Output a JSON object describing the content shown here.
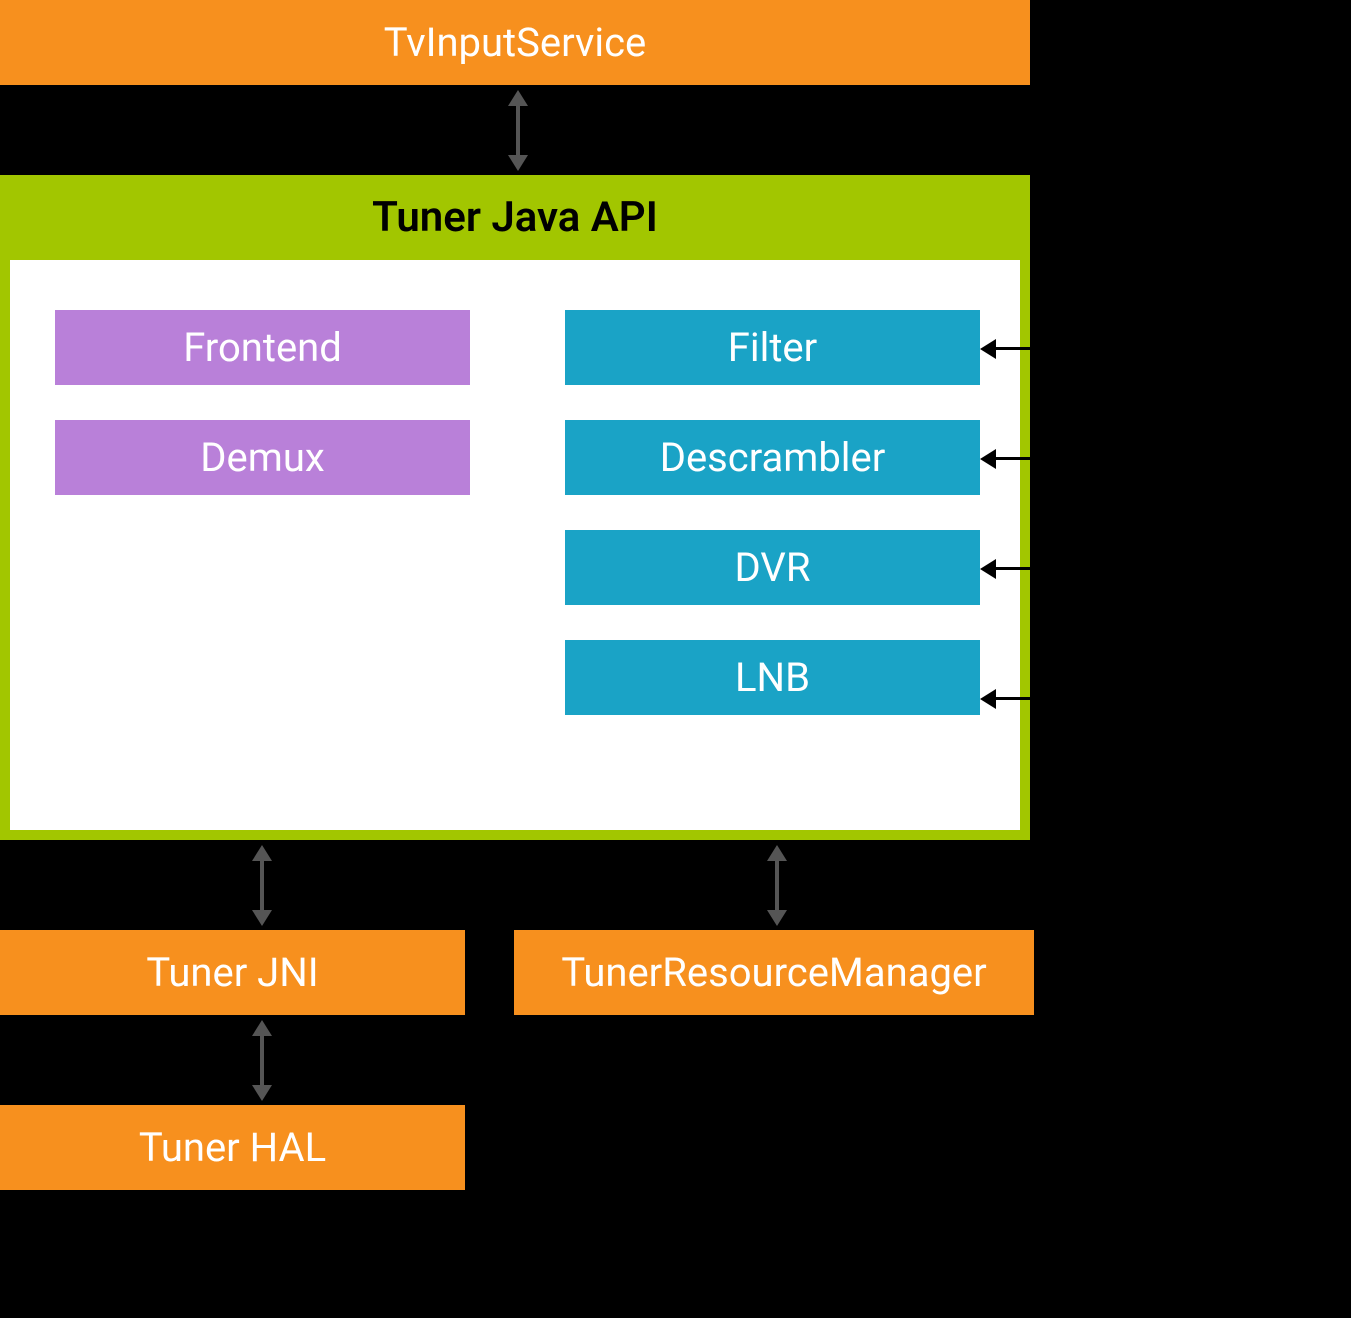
{
  "top": {
    "tv_input_service": "TvInputService"
  },
  "tuner_api": {
    "header": "Tuner Java API",
    "left": {
      "frontend": "Frontend",
      "demux": "Demux"
    },
    "right": {
      "filter": "Filter",
      "descrambler": "Descrambler",
      "dvr": "DVR",
      "lnb": "LNB"
    }
  },
  "bottom": {
    "tuner_jni": "Tuner JNI",
    "trm": "TunerResourceManager",
    "tuner_hal": "Tuner HAL"
  },
  "colors": {
    "orange": "#f7901e",
    "lime": "#a2c600",
    "purple": "#b980d9",
    "cyan": "#1aa3c6"
  }
}
